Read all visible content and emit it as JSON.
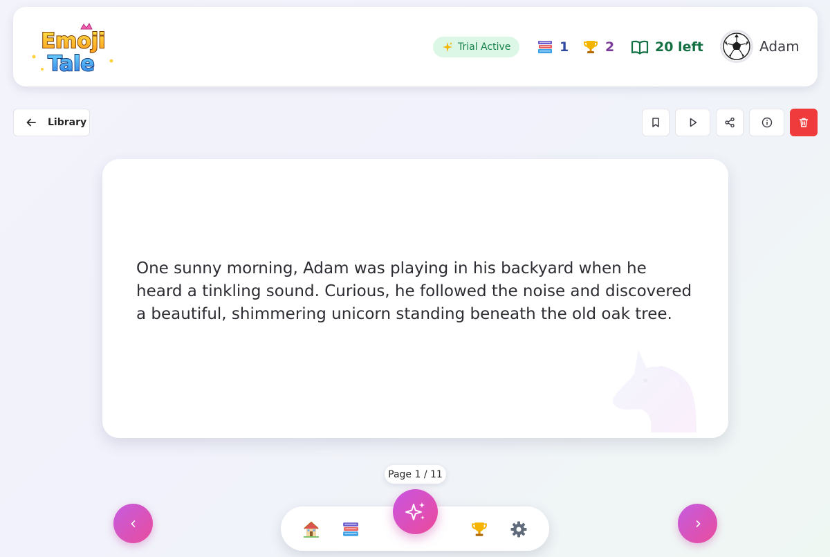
{
  "header": {
    "logo_line1": "Emoji",
    "logo_line2": "Tale",
    "trial_badge": "Trial Active",
    "books_count": "1",
    "trophies_count": "2",
    "pages_left": "20 left",
    "user_name": "Adam"
  },
  "toolbar": {
    "library_label": "Library",
    "icons": [
      "bookmark-icon",
      "play-icon",
      "share-icon",
      "info-icon",
      "trash-icon"
    ]
  },
  "story": {
    "text": "One sunny morning, Adam was playing in his backyard when he heard a tinkling sound. Curious, he followed the noise and discovered a beautiful, shimmering unicorn standing beneath the old oak tree."
  },
  "pagination": {
    "page_label": "Page 1 / 11"
  },
  "dock": {
    "items": [
      "home-icon",
      "books-icon",
      "magic-sparkle-icon",
      "trophy-icon",
      "gear-icon"
    ]
  },
  "colors": {
    "accent_gradient_start": "#c55ce0",
    "accent_gradient_end": "#e94c9c",
    "delete": "#ef3b3b",
    "trial_bg": "#dcf7e6",
    "trial_text": "#17804a",
    "books_stat": "#2f4aa3",
    "trophies_stat": "#7a3a9a",
    "pages_left_stat": "#137043"
  }
}
